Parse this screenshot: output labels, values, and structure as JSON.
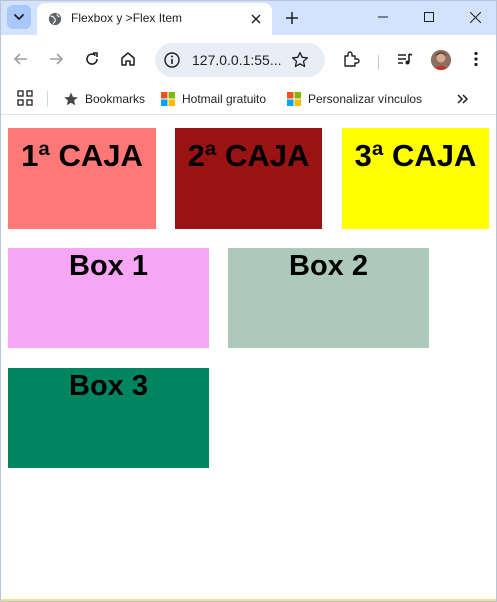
{
  "browser": {
    "tab": {
      "title": "Flexbox y >Flex Item"
    },
    "omnibox": {
      "url": "127.0.0.1:55..."
    },
    "bookmarks": [
      {
        "label": "Bookmarks",
        "icon": "star-icon"
      },
      {
        "label": "Hotmail gratuito",
        "icon": "microsoft-logo-icon"
      },
      {
        "label": "Personalizar vínculos",
        "icon": "microsoft-logo-icon"
      }
    ],
    "colors": {
      "tabstrip": "#d3e3fd",
      "omnibox": "#e9eef6"
    }
  },
  "page": {
    "row1": [
      {
        "label": "1ª CAJA",
        "color": "#ff7878"
      },
      {
        "label": "2ª CAJA",
        "color": "#991313"
      },
      {
        "label": "3ª CAJA",
        "color": "#ffff00"
      }
    ],
    "row2": [
      {
        "label": "Box 1",
        "color": "#f6a6f4"
      },
      {
        "label": "Box 2",
        "color": "#adc9bc"
      }
    ],
    "row3": [
      {
        "label": "Box 3",
        "color": "#008560"
      }
    ]
  }
}
